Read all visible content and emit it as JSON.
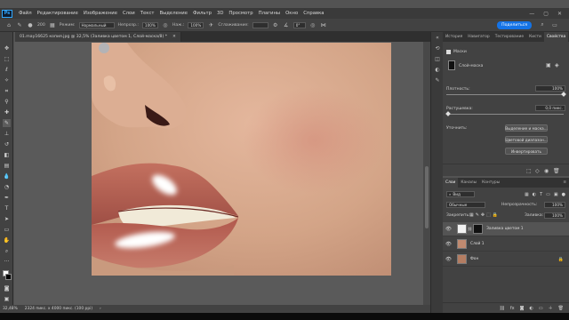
{
  "menubar": {
    "logo": "Ps",
    "items": [
      "Файл",
      "Редактирование",
      "Изображение",
      "Слои",
      "Текст",
      "Выделение",
      "Фильтр",
      "3D",
      "Просмотр",
      "Плагины",
      "Окно",
      "Справка"
    ]
  },
  "options": {
    "brush_size": "200",
    "mode_label": "Режим:",
    "mode_value": "Нормальный",
    "opacity_label": "Непрозр.:",
    "opacity_value": "100%",
    "flow_label": "Наж.:",
    "flow_value": "100%",
    "smoothing_label": "Сглаживание:",
    "angle_value": "0°",
    "share_label": "Поделиться"
  },
  "document": {
    "tab_title": "01.may16625 копия.jpg @ 32,5% (Заливка цветом 1, Слой-маска/8) *"
  },
  "status": {
    "zoom": "32,48%",
    "info": "2324 пикс. x 4000 пикс. (100 ppi)"
  },
  "properties_panel": {
    "tabs": [
      "История",
      "Навигатор",
      "Тестирование",
      "Кисти",
      "Свойства"
    ],
    "active_tab": "Свойства",
    "section_title": "Маски",
    "mask_label": "Слой-маска",
    "density_label": "Плотность:",
    "density_value": "100%",
    "feather_label": "Растушевка:",
    "feather_value": "0,0 пикс.",
    "refine_label": "Уточнить:",
    "buttons": [
      "Выделение и маска...",
      "Цветовой диапазон...",
      "Инвертировать"
    ],
    "density_fraction": 1.0,
    "feather_fraction": 0.0
  },
  "layers_panel": {
    "tabs": [
      "Слои",
      "Каналы",
      "Контуры"
    ],
    "active_tab": "Слои",
    "filter_label": "Вид",
    "blend_mode": "Обычные",
    "opacity_label": "Непрозрачность:",
    "opacity_value": "100%",
    "lock_label": "Закрепить:",
    "fill_label": "Заливка:",
    "fill_value": "100%",
    "layers": [
      {
        "name": "Заливка цветом 1",
        "selected": true,
        "locked": false
      },
      {
        "name": "Слой 1",
        "selected": false,
        "locked": false
      },
      {
        "name": "Фон",
        "selected": false,
        "locked": true
      }
    ]
  },
  "colors": {
    "accent": "#1473e6",
    "foreground_swatch": "#ffffff",
    "background_swatch": "#000000"
  }
}
